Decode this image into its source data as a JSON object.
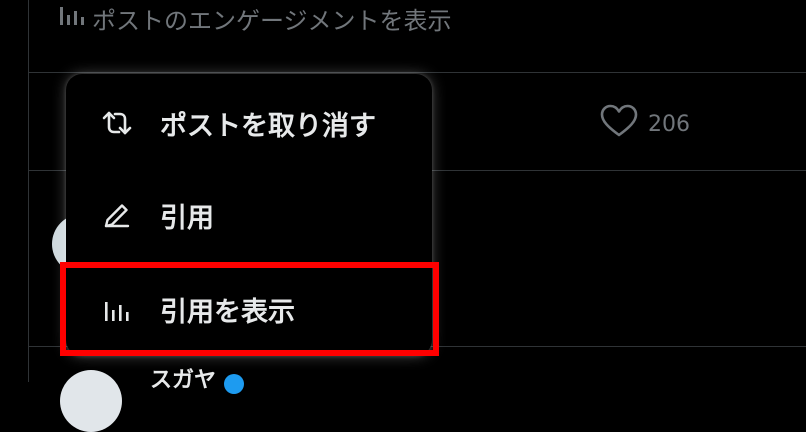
{
  "background": {
    "engagement_text": "ポストのエンゲージメントを表示",
    "like_count": "206",
    "bottom_text": "スガヤ"
  },
  "menu": {
    "items": [
      {
        "label": "ポストを取り消す",
        "icon": "undo-repost-icon"
      },
      {
        "label": "引用",
        "icon": "pen-icon"
      },
      {
        "label": "引用を表示",
        "icon": "bar-chart-icon"
      }
    ]
  },
  "colors": {
    "background": "#000000",
    "muted_text": "#71767b",
    "primary_text": "#e7e9ea",
    "divider": "#2f3336",
    "highlight": "#ff0000",
    "verified": "#1d9bf0"
  }
}
